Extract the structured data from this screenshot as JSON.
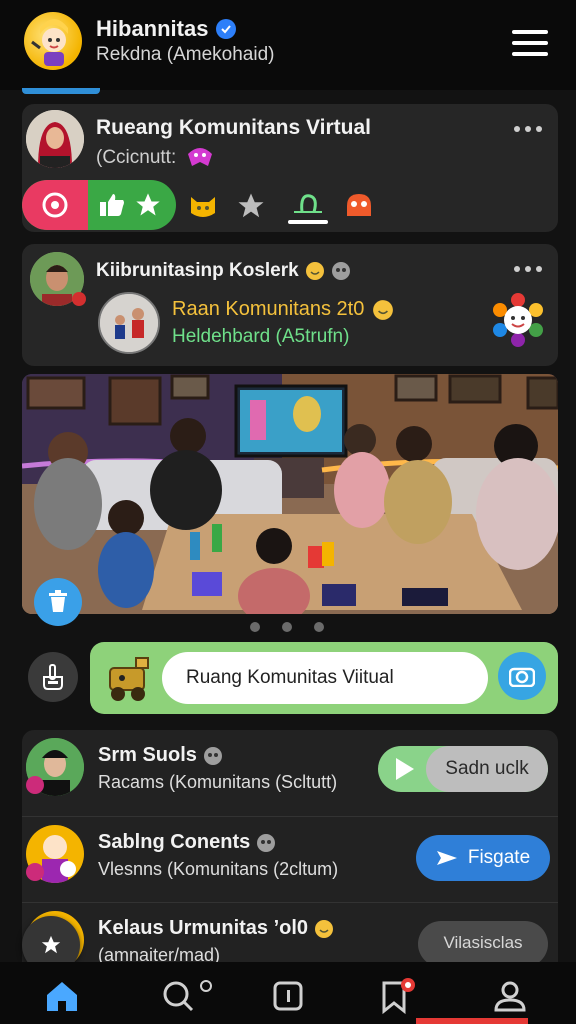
{
  "header": {
    "title": "Hibannitas",
    "subtitle": "Rekdna (Amekohaid)"
  },
  "post1": {
    "name": "Rueang Komunitans Virtual",
    "sub": "(Ccicnutt:"
  },
  "post2": {
    "name": "Kiibrunitasinp Koslerk",
    "inner_title": "Raan Komunitans 2t0",
    "inner_sub": "Heldehbard (A5trufn)"
  },
  "composer": {
    "input_text": "Ruang Komunitas Viitual"
  },
  "list": [
    {
      "name": "Srm Suols",
      "sub": "Racams (Komunitans (Scltutt)",
      "action": "Sadn uclk"
    },
    {
      "name": "Sablng Conents",
      "sub": "Vlesnns (Komunitans (2cltum)",
      "action": "Fisgate"
    },
    {
      "name": "Kelaus Urmunitas ’ol0",
      "sub": "(amnaiter/mad)",
      "action": "Vilasisclas"
    }
  ],
  "colors": {
    "accent_green": "#3aa845",
    "accent_pink": "#e93a62",
    "accent_blue": "#2f7fd8",
    "background": "#121212"
  }
}
